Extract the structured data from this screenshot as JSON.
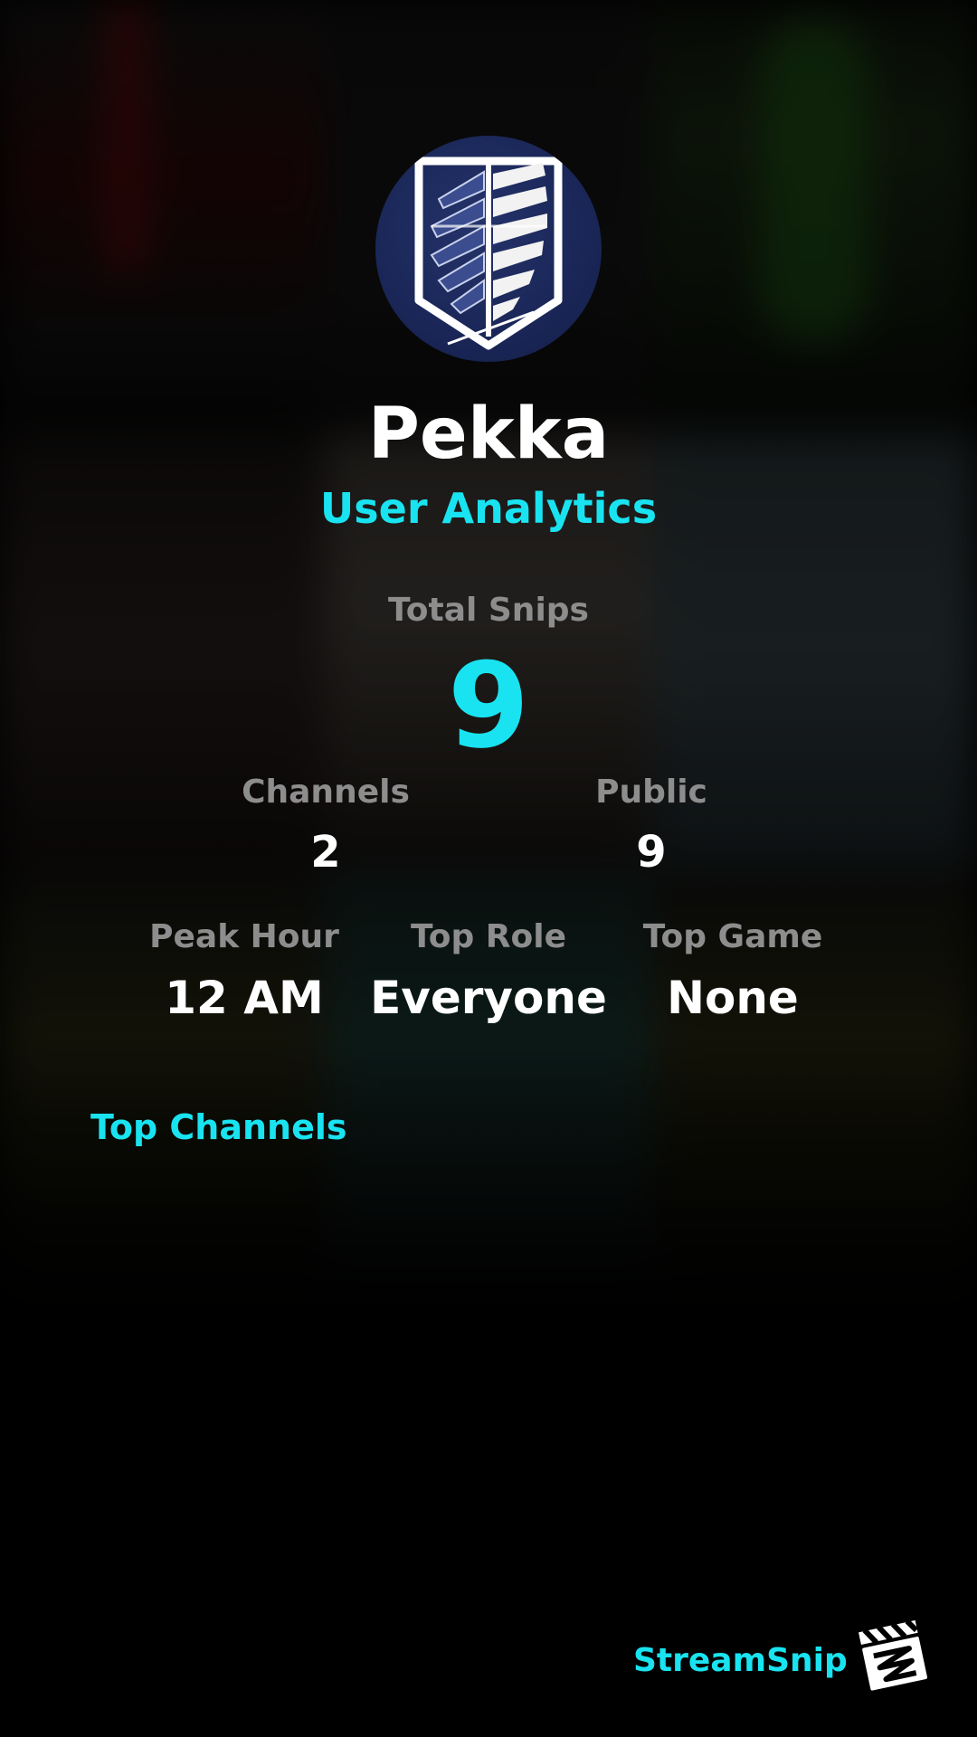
{
  "user": {
    "name": "Pekka",
    "subtitle": "User Analytics"
  },
  "stats": {
    "total_snips_label": "Total Snips",
    "total_snips_value": "9",
    "channels_label": "Channels",
    "channels_value": "2",
    "public_label": "Public",
    "public_value": "9",
    "peak_hour_label": "Peak Hour",
    "peak_hour_value": "12 AM",
    "top_role_label": "Top Role",
    "top_role_value": "Everyone",
    "top_game_label": "Top Game",
    "top_game_value": "None"
  },
  "sections": {
    "top_channels_title": "Top Channels"
  },
  "footer": {
    "brand": "StreamSnip",
    "logo_icon": "clapperboard-icon"
  },
  "avatar_icon": "wings-of-freedom-emblem-icon",
  "colors": {
    "accent": "#19e3f0",
    "label": "#8d8d8d",
    "value": "#ffffff",
    "background": "#000000",
    "avatar_bg": "#1a2657"
  }
}
